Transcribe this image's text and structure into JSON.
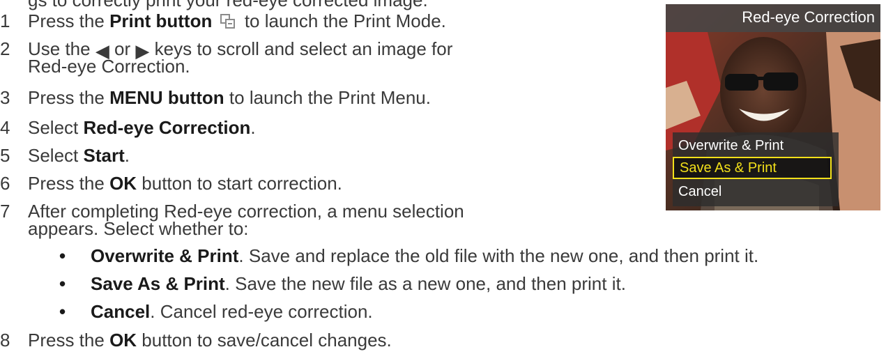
{
  "intro_line": "gs to correctly print your red-eye corrected image.",
  "steps": [
    {
      "num": "1",
      "pre": "Press the ",
      "bold": "Print button",
      "post": " to launch the Print Mode."
    },
    {
      "num": "2",
      "pre": "Use the ",
      "left_key": "◀",
      "mid": " or ",
      "right_key": "▶",
      "post": " keys to scroll and select an image for",
      "cont": "Red-eye Correction."
    },
    {
      "num": "3",
      "pre": "Press the ",
      "bold": "MENU button",
      "post": " to launch the Print Menu."
    },
    {
      "num": "4",
      "pre": "Select ",
      "bold": "Red-eye Correction",
      "post": "."
    },
    {
      "num": "5",
      "pre": "Select ",
      "bold": "Start",
      "post": "."
    },
    {
      "num": "6",
      "pre": "Press the ",
      "bold": "OK",
      "post": " button to start correction."
    },
    {
      "num": "7",
      "pre": "After completing Red-eye correction, a menu selection",
      "cont": "appears. Select whether to:"
    },
    {
      "num": "8",
      "pre": "Press the ",
      "bold": "OK",
      "post": " button to save/cancel changes."
    }
  ],
  "bullets": [
    {
      "bold": "Overwrite & Print",
      "text": ". Save and replace the old file with the new one, and then print it."
    },
    {
      "bold": "Save As & Print",
      "text": ". Save the new file as a new one, and then print it."
    },
    {
      "bold": "Cancel",
      "text": ". Cancel red-eye correction."
    }
  ],
  "bullet_symbol": "•",
  "icons": {
    "print": "print-icon"
  },
  "screen": {
    "title": "Red-eye Correction",
    "menu": [
      {
        "label": "Overwrite & Print",
        "selected": false
      },
      {
        "label": "Save As & Print",
        "selected": true
      },
      {
        "label": "Cancel",
        "selected": false
      }
    ],
    "highlight_color": "#f2e01a"
  }
}
